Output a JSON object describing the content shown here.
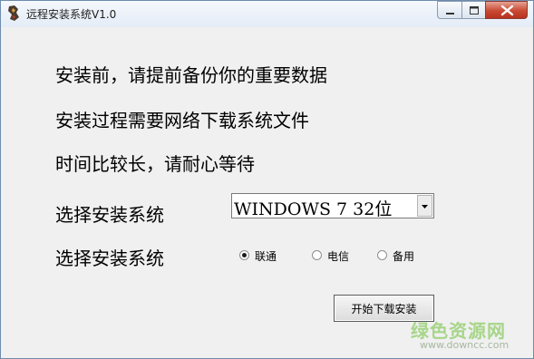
{
  "window": {
    "title": "远程安装系统V1.0",
    "controls": {
      "minimize_icon": "minimize-icon",
      "maximize_icon": "maximize-icon",
      "close_icon": "close-icon"
    }
  },
  "content": {
    "line1": "安装前，请提前备份你的重要数据",
    "line2": "安装过程需要网络下载系统文件",
    "line3": "时间比较长，请耐心等待",
    "select_label": "选择安装系统",
    "select_value": "WINDOWS 7 32位",
    "radio_label": "选择安装系统",
    "radios": [
      {
        "label": "联通",
        "checked": true
      },
      {
        "label": "电信",
        "checked": false
      },
      {
        "label": "备用",
        "checked": false
      }
    ],
    "start_button": "开始下载安装"
  },
  "watermark": {
    "text": "绿色资源网",
    "url": "www.downcc.com"
  },
  "colors": {
    "title_bar": "#e4ecf7",
    "close_button": "#c94a33",
    "window_bg": "#f0f0f0"
  }
}
